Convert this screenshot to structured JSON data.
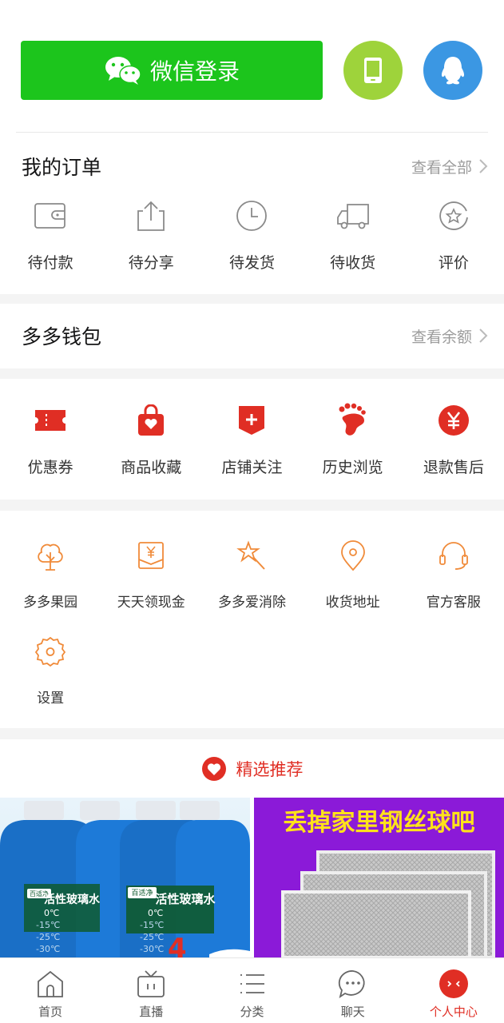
{
  "login": {
    "wechat_label": "微信登录"
  },
  "orders": {
    "title": "我的订单",
    "more": "查看全部",
    "items": [
      {
        "label": "待付款",
        "icon": "wallet-icon"
      },
      {
        "label": "待分享",
        "icon": "share-icon"
      },
      {
        "label": "待发货",
        "icon": "clock-icon"
      },
      {
        "label": "待收货",
        "icon": "truck-icon"
      },
      {
        "label": "评价",
        "icon": "star-comment-icon"
      }
    ]
  },
  "wallet": {
    "title": "多多钱包",
    "more": "查看余额"
  },
  "quick": {
    "items": [
      {
        "label": "优惠券",
        "icon": "coupon-icon"
      },
      {
        "label": "商品收藏",
        "icon": "bag-heart-icon"
      },
      {
        "label": "店铺关注",
        "icon": "store-plus-icon"
      },
      {
        "label": "历史浏览",
        "icon": "footprint-icon"
      },
      {
        "label": "退款售后",
        "icon": "yuan-icon"
      }
    ]
  },
  "services": {
    "items": [
      {
        "label": "多多果园",
        "icon": "tree-icon"
      },
      {
        "label": "天天领现金",
        "icon": "cash-envelope-icon"
      },
      {
        "label": "多多爱消除",
        "icon": "star-wand-icon"
      },
      {
        "label": "收货地址",
        "icon": "location-icon"
      },
      {
        "label": "官方客服",
        "icon": "headset-icon"
      },
      {
        "label": "设置",
        "icon": "gear-icon"
      }
    ]
  },
  "recommend": {
    "title": "精选推荐",
    "products": [
      {
        "brand": "百适净",
        "name": "活性玻璃水",
        "temps": [
          "0℃",
          "-15℃",
          "-25℃",
          "-30℃"
        ],
        "promo": "4"
      },
      {
        "headline": "丢掉家里钢丝球吧"
      }
    ]
  },
  "tabbar": {
    "items": [
      {
        "label": "首页",
        "icon": "home-icon"
      },
      {
        "label": "直播",
        "icon": "tv-icon"
      },
      {
        "label": "分类",
        "icon": "list-icon"
      },
      {
        "label": "聊天",
        "icon": "chat-icon"
      },
      {
        "label": "个人中心",
        "icon": "profile-icon",
        "active": true
      }
    ]
  },
  "colors": {
    "wechat": "#1cc51c",
    "phone": "#9ed33b",
    "qq": "#3b97e3",
    "accent": "#e02e24",
    "service_orange": "#f08b3a"
  }
}
